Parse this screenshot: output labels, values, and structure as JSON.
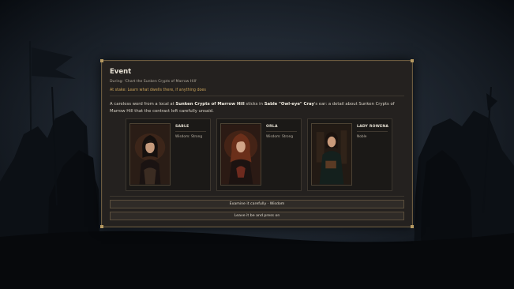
{
  "event": {
    "title": "Event",
    "during": "During: 'Chart the Sunken Crypts of Marrow Hill'",
    "at_stake": "At stake: Learn what dwells there, if anything does"
  },
  "narrative": {
    "part1": "A careless word from a local at ",
    "place": "Sunken Crypts of Marrow Hill",
    "part2": " sticks in ",
    "person": "Sable \"Owl-eye\" Cray",
    "part3": "'s ear: a detail about Sunken Crypts of Marrow Hill that the contract left carefully unsaid."
  },
  "characters": [
    {
      "name": "SABLE",
      "trait": "Wisdom: Strong",
      "portrait_icon": "dark-haired-woman-portrait"
    },
    {
      "name": "ORLA",
      "trait": "Wisdom: Strong",
      "portrait_icon": "red-haired-woman-portrait"
    },
    {
      "name": "LADY ROWENA",
      "trait": "Noble",
      "portrait_icon": "noblewoman-with-book-portrait"
    }
  ],
  "choices": [
    {
      "label": "Examine it carefully  ·  Wisdom"
    },
    {
      "label": "Leave it be and press on"
    }
  ],
  "colors": {
    "panel": "#24211f",
    "border": "#6b5a3f",
    "accent": "#c9a25a",
    "background": "#1b222c"
  }
}
